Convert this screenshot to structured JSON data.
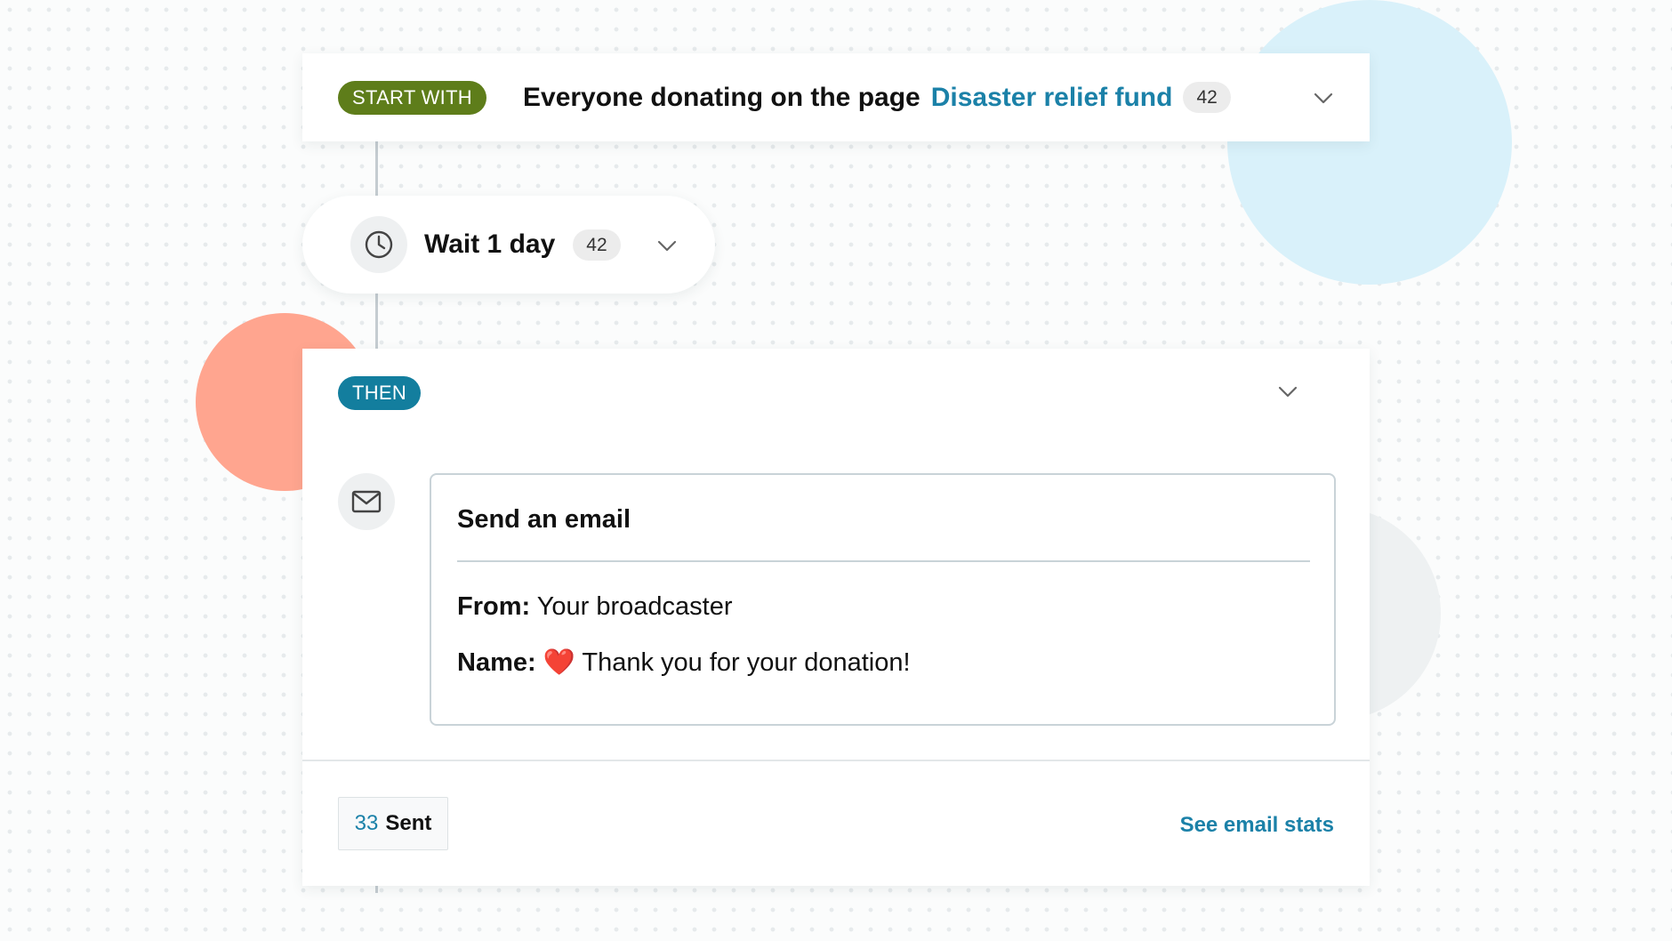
{
  "colors": {
    "start_badge": "#5e7d1a",
    "then_badge": "#137e9e",
    "link": "#1b81a8",
    "blob_blue": "#d9f1fa",
    "blob_salmon": "#ffa58f"
  },
  "start": {
    "badge": "START WITH",
    "title": "Everyone donating on the page",
    "page_link": "Disaster relief fund",
    "count": "42",
    "expand_icon": "chevron-down-icon"
  },
  "wait": {
    "icon": "clock-icon",
    "title": "Wait 1 day",
    "count": "42",
    "expand_icon": "chevron-down-icon"
  },
  "then": {
    "badge": "THEN",
    "expand_icon": "chevron-down-icon",
    "action_icon": "envelope-icon",
    "email": {
      "title": "Send an email",
      "from_label": "From:",
      "from_value": "Your broadcaster",
      "name_label": "Name:",
      "name_emoji": "❤️",
      "name_value": "Thank you for your donation!"
    },
    "sent_count": "33",
    "sent_label": "Sent",
    "stats_link": "See email stats"
  }
}
